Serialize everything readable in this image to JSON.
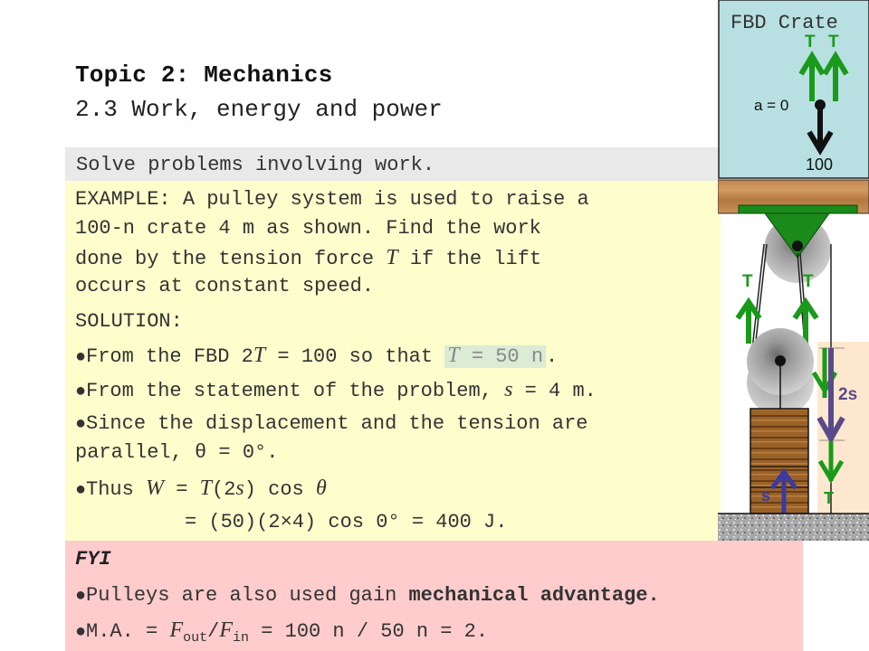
{
  "header": {
    "title": "Topic 2: Mechanics",
    "subtitle": "2.3 Work, energy and power"
  },
  "objective": "Solve problems involving work.",
  "example": {
    "lines": [
      "EXAMPLE: A pulley system is used to raise a",
      "100-n crate 4 m as shown. Find the work",
      "done by the tension force ",
      "occurs at constant speed."
    ],
    "line3_var": "T",
    "line3_tail": " if the lift",
    "solution_label": "SOLUTION:",
    "bullet1_pre": "From the FBD 2",
    "bullet1_var": "T",
    "bullet1_mid": " = 100 so that ",
    "bullet1_highlight_var": "T",
    "bullet1_highlight_rest": " = 50 n",
    "bullet1_end": ".",
    "bullet2_pre": "From the statement of the problem, ",
    "bullet2_var": "s",
    "bullet2_end": " = 4 m.",
    "bullet3_line1": "Since the displacement and the tension are",
    "bullet3_line2": "parallel, θ = 0°.",
    "bullet4_pre": "Thus ",
    "bullet4_W": "W",
    "bullet4_eq": " = ",
    "bullet4_T": "T",
    "bullet4_paren_open": "(2",
    "bullet4_s": "s",
    "bullet4_paren_close": ") cos ",
    "bullet4_theta": "θ",
    "result_line": "= (50)(2×4) cos 0° = 400 J.",
    "bullet_symbol": "●"
  },
  "fyi": {
    "heading": "FYI",
    "bullet1_pre": "Pulleys are also used gain ",
    "bullet1_bold": "mechanical advantage.",
    "bullet2_pre": "M.A. = ",
    "bullet2_F": "F",
    "bullet2_out": "out",
    "bullet2_slash": "/",
    "bullet2_in": "in",
    "bullet2_end": " = 100 n / 50 n = 2."
  },
  "diagram": {
    "fbd_title": "FBD Crate",
    "tension_label": "T",
    "accel_label": "a = 0",
    "weight_label": "100",
    "displacement_2s": "2s",
    "displacement_s": "s",
    "colors": {
      "fbd_bg": "#b8e0e2",
      "green": "#1a9a1a",
      "purple": "#5a4a8a",
      "blue": "#3a3aa0",
      "range_bg": "#fde8cf"
    }
  }
}
